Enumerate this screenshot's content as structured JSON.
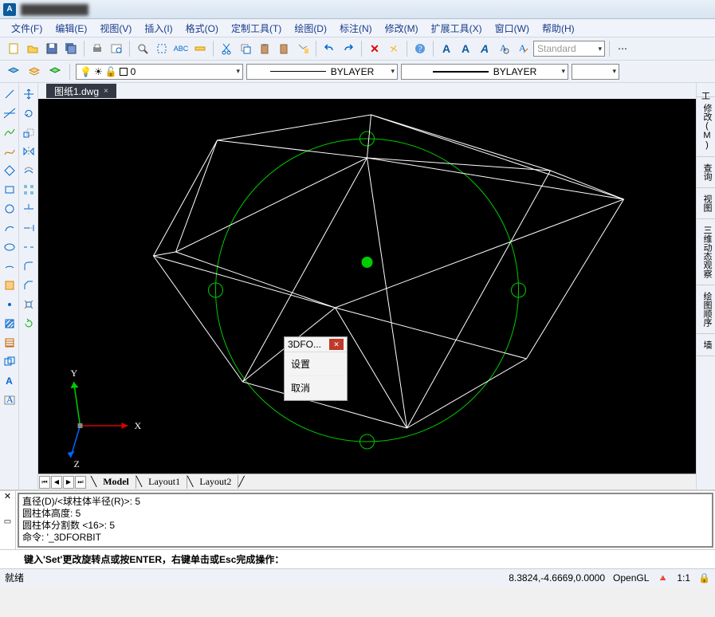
{
  "app": {
    "icon": "A",
    "title": "██████████"
  },
  "menu": [
    "文件(F)",
    "编辑(E)",
    "视图(V)",
    "插入(I)",
    "格式(O)",
    "定制工具(T)",
    "绘图(D)",
    "标注(N)",
    "修改(M)",
    "扩展工具(X)",
    "窗口(W)",
    "帮助(H)"
  ],
  "style_combo": "Standard",
  "layer_combo": "0",
  "bylayer": "BYLAYER",
  "doc_tab": "图纸1.dwg",
  "model_tabs": [
    "Model",
    "Layout1",
    "Layout2"
  ],
  "right_panels": [
    "工",
    "修改(M)",
    "查询",
    "视图",
    "三维动态观察",
    "绘图顺序",
    "墙"
  ],
  "cmd_history": [
    "直径(D)/<球柱体半径(R)>: 5",
    "圆柱体高度: 5",
    "圆柱体分割数 <16>: 5",
    "命令: '_3DFORBIT"
  ],
  "prompt": "键入'Set'更改旋转点或按ENTER，右键单击或Esc完成操作：",
  "status": {
    "left": "就绪",
    "coords": "8.3824,-4.6669,0.0000",
    "render": "OpenGL",
    "scale": "1:1"
  },
  "context": {
    "title": "3DFO...",
    "items": [
      "设置",
      "取消"
    ]
  },
  "axes": {
    "x": "X",
    "y": "Y",
    "z": "Z"
  }
}
